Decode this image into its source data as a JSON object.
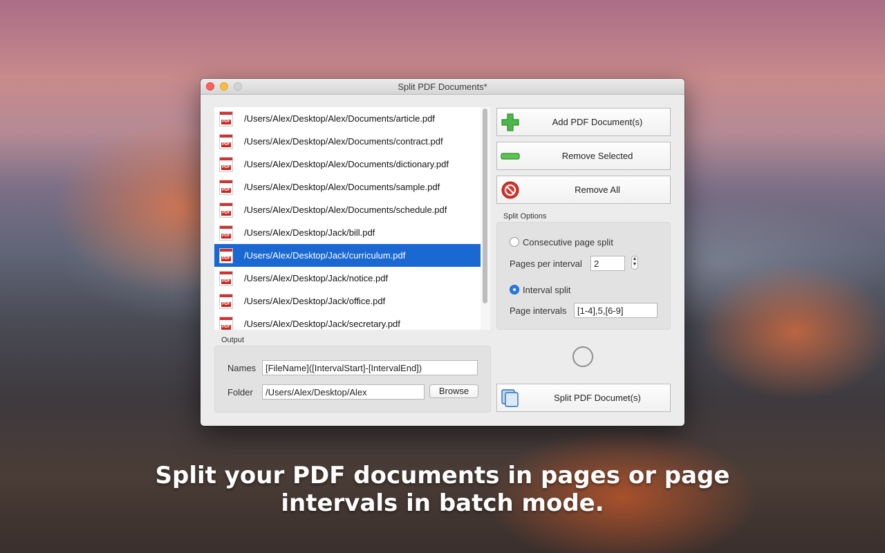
{
  "window": {
    "title": "Split PDF Documents*"
  },
  "files": [
    "/Users/Alex/Desktop/Alex/Documents/article.pdf",
    "/Users/Alex/Desktop/Alex/Documents/contract.pdf",
    "/Users/Alex/Desktop/Alex/Documents/dictionary.pdf",
    "/Users/Alex/Desktop/Alex/Documents/sample.pdf",
    "/Users/Alex/Desktop/Alex/Documents/schedule.pdf",
    "/Users/Alex/Desktop/Jack/bill.pdf",
    "/Users/Alex/Desktop/Jack/curriculum.pdf",
    "/Users/Alex/Desktop/Jack/notice.pdf",
    "/Users/Alex/Desktop/Jack/office.pdf",
    "/Users/Alex/Desktop/Jack/secretary.pdf"
  ],
  "selected_file": "/Users/Alex/Desktop/Jack/curriculum.pdf",
  "file_icon_text": "PDF",
  "buttons": {
    "add": "Add PDF Document(s)",
    "remove_selected": "Remove Selected",
    "remove_all": "Remove All",
    "split": "Split PDF Documet(s)",
    "browse": "Browse"
  },
  "split_options": {
    "label": "Split Options",
    "consecutive_label": "Consecutive page split",
    "pages_per_interval_label": "Pages per interval",
    "pages_per_interval_value": "2",
    "interval_split_label": "Interval split",
    "page_intervals_label": "Page intervals",
    "page_intervals_value": "[1-4],5,[6-9]",
    "selected_mode": "interval"
  },
  "output": {
    "label": "Output",
    "names_label": "Names",
    "names_value": "[FileName]([IntervalStart]-[IntervalEnd])",
    "folder_label": "Folder",
    "folder_value": "/Users/Alex/Desktop/Alex"
  },
  "caption": {
    "line1": "Split your PDF documents in pages or page",
    "line2": "intervals in batch mode."
  },
  "colors": {
    "selection": "#1a68d2",
    "add_icon": "#4cb84a",
    "remove_icon": "#5cc44f",
    "remove_all_icon": "#d8322a"
  }
}
